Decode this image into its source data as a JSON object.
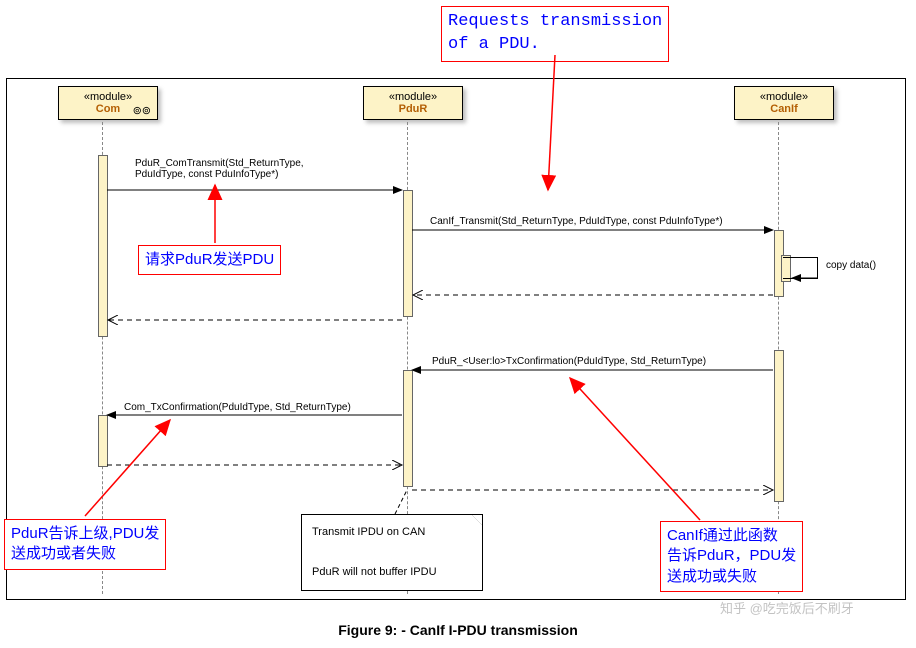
{
  "lifelines": {
    "com": {
      "stereo": "«module»",
      "name": "Com"
    },
    "pdur": {
      "stereo": "«module»",
      "name": "PduR"
    },
    "canif": {
      "stereo": "«module»",
      "name": "CanIf"
    }
  },
  "messages": {
    "m1": "PduR_ComTransmit(Std_ReturnType,\nPduIdType, const PduInfoType*)",
    "m2": "CanIf_Transmit(Std_ReturnType, PduIdType, const PduInfoType*)",
    "m3": "copy data()",
    "m4": "PduR_<User:lo>TxConfirmation(PduIdType, Std_ReturnType)",
    "m5": "Com_TxConfirmation(PduIdType, Std_ReturnType)"
  },
  "annotations": {
    "top": "Requests transmission\nof a PDU.",
    "mid": "请求PduR发送PDU",
    "bl": "PduR告诉上级,PDU发\n送成功或者失败",
    "br": "CanIf通过此函数\n告诉PduR，PDU发\n送成功或失败"
  },
  "note": "Transmit IPDU on CAN\n\nPduR will not buffer IPDU",
  "caption": "Figure 9: - CanIf I-PDU transmission",
  "watermark": "知乎 @吃完饭后不刷牙",
  "chart_data": {
    "type": "sequence-diagram",
    "title": "CanIf I-PDU transmission",
    "lifelines": [
      "Com",
      "PduR",
      "CanIf"
    ],
    "messages": [
      {
        "from": "Com",
        "to": "PduR",
        "label": "PduR_ComTransmit(Std_ReturnType, PduIdType, const PduInfoType*)",
        "kind": "sync"
      },
      {
        "from": "PduR",
        "to": "CanIf",
        "label": "CanIf_Transmit(Std_ReturnType, PduIdType, const PduInfoType*)",
        "kind": "sync"
      },
      {
        "from": "CanIf",
        "to": "CanIf",
        "label": "copy data()",
        "kind": "self"
      },
      {
        "from": "CanIf",
        "to": "PduR",
        "label": "",
        "kind": "return"
      },
      {
        "from": "PduR",
        "to": "Com",
        "label": "",
        "kind": "return"
      },
      {
        "from": "CanIf",
        "to": "PduR",
        "label": "PduR_<User:lo>TxConfirmation(PduIdType, Std_ReturnType)",
        "kind": "sync"
      },
      {
        "from": "PduR",
        "to": "Com",
        "label": "Com_TxConfirmation(PduIdType, Std_ReturnType)",
        "kind": "sync"
      },
      {
        "from": "Com",
        "to": "PduR",
        "label": "",
        "kind": "return"
      },
      {
        "from": "PduR",
        "to": "CanIf",
        "label": "",
        "kind": "return"
      }
    ],
    "note": {
      "attached_to": "PduR",
      "text": "Transmit IPDU on CAN / PduR will not buffer IPDU"
    },
    "annotations": [
      {
        "text": "Requests transmission of a PDU.",
        "points_to": "CanIf_Transmit"
      },
      {
        "text": "请求PduR发送PDU",
        "points_to": "PduR_ComTransmit"
      },
      {
        "text": "PduR告诉上级,PDU发送成功或者失败",
        "points_to": "Com_TxConfirmation"
      },
      {
        "text": "CanIf通过此函数告诉PduR，PDU发送成功或失败",
        "points_to": "PduR_<User:lo>TxConfirmation"
      }
    ]
  }
}
